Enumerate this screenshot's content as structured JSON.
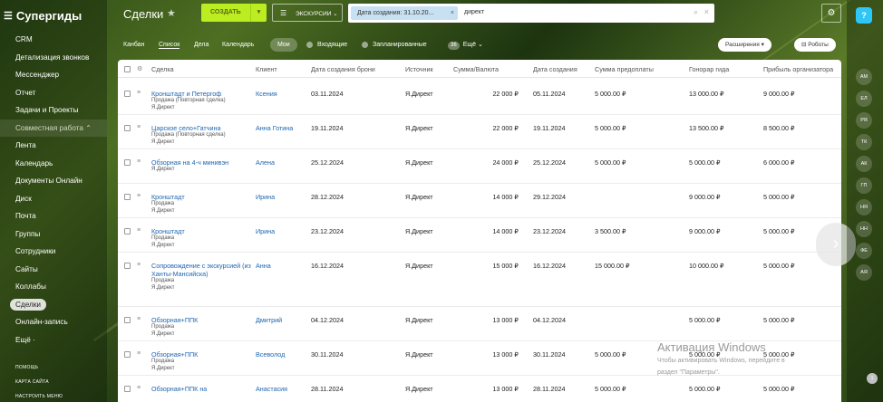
{
  "sidebar": {
    "brand": "Супергиды",
    "items": [
      {
        "label": "CRM"
      },
      {
        "label": "Детализация звонков"
      },
      {
        "label": "Мессенджер"
      },
      {
        "label": "Отчет"
      },
      {
        "label": "Задачи и Проекты"
      },
      {
        "label": "Совместная работа ⌃",
        "group": true
      },
      {
        "label": "Лента"
      },
      {
        "label": "Календарь"
      },
      {
        "label": "Документы Онлайн"
      },
      {
        "label": "Диск"
      },
      {
        "label": "Почта"
      },
      {
        "label": "Группы"
      },
      {
        "label": "Сотрудники"
      },
      {
        "label": "Сайты"
      },
      {
        "label": "Коллабы"
      },
      {
        "label": "Сделки",
        "active": true
      },
      {
        "label": "Онлайн-запись"
      },
      {
        "label": "Ещё ·"
      }
    ],
    "bottom": [
      "ПОМОЩЬ",
      "КАРТА САЙТА",
      "НАСТРОИТЬ МЕНЮ"
    ]
  },
  "header": {
    "title": "Сделки",
    "create_label": "СОЗДАТЬ",
    "excursions_label": "ЭКСКУРСИИ ⌄",
    "filter_chip": "Дата создания: 31.10.20...",
    "search_value": "директ"
  },
  "views": {
    "tabs": [
      "Канбан",
      "Список",
      "Дела",
      "Календарь"
    ],
    "active_tab": "Список",
    "my_label": "Мои",
    "incoming_label": "Входящие",
    "planned_label": "Запланированные",
    "more_count": "36",
    "more_label": "Ещё ⌄",
    "extensions_label": "Расширения ▾",
    "robots_label": "Роботы"
  },
  "table": {
    "columns": [
      "Сделка",
      "Клиент",
      "Дата создания брони",
      "Источник",
      "Сумма/Валюта",
      "Дата создания",
      "Сумма предоплаты",
      "Гонорар гида",
      "Прибыль организатора"
    ],
    "rows": [
      {
        "name": "Кронштадт и Петергоф",
        "sub1": "Продажа (Повторная сделка)",
        "sub2": "Я.Директ",
        "client": "Ксения",
        "booking": "03.11.2024",
        "source": "Я.Директ",
        "sum": "22 000 ₽",
        "created": "05.11.2024",
        "prepay": "5 000.00 ₽",
        "fee": "13 000.00 ₽",
        "profit": "9 000.00 ₽"
      },
      {
        "name": "Царское село+Гатчина",
        "sub1": "Продажа (Повторная сделка)",
        "sub2": "Я.Директ",
        "client": "Анна Готина",
        "booking": "19.11.2024",
        "source": "Я.Директ",
        "sum": "22 000 ₽",
        "created": "19.11.2024",
        "prepay": "5 000.00 ₽",
        "fee": "13 500.00 ₽",
        "profit": "8 500.00 ₽"
      },
      {
        "name": "Обзорная на 4-ч минивэн",
        "sub1": "",
        "sub2": "Я.Директ",
        "client": "Алена",
        "booking": "25.12.2024",
        "source": "Я.Директ",
        "sum": "24 000 ₽",
        "created": "25.12.2024",
        "prepay": "5 000.00 ₽",
        "fee": "5 000.00 ₽",
        "profit": "6 000.00 ₽"
      },
      {
        "name": "Кронштадт",
        "sub1": "Продажа",
        "sub2": "Я.Директ",
        "client": "Ирина",
        "booking": "28.12.2024",
        "source": "Я.Директ",
        "sum": "14 000 ₽",
        "created": "29.12.2024",
        "prepay": "",
        "fee": "9 000.00 ₽",
        "profit": "5 000.00 ₽"
      },
      {
        "name": "Кронштадт",
        "sub1": "Продажа",
        "sub2": "Я.Директ",
        "client": "Ирина",
        "booking": "23.12.2024",
        "source": "Я.Директ",
        "sum": "14 000 ₽",
        "created": "23.12.2024",
        "prepay": "3 500.00 ₽",
        "fee": "9 000.00 ₽",
        "profit": "5 000.00 ₽"
      },
      {
        "name": "Сопровождение с экскурсией (из Ханты-Мансийска)",
        "sub1": "Продажа",
        "sub2": "Я.Директ",
        "client": "Анна",
        "booking": "16.12.2024",
        "source": "Я.Директ",
        "sum": "15 000 ₽",
        "created": "16.12.2024",
        "prepay": "15 000.00 ₽",
        "fee": "10 000.00 ₽",
        "profit": "5 000.00 ₽"
      },
      {
        "name": "Обзорная+ППК",
        "sub1": "Продажа",
        "sub2": "Я.Директ",
        "client": "Дмитрий",
        "booking": "04.12.2024",
        "source": "Я.Директ",
        "sum": "13 000 ₽",
        "created": "04.12.2024",
        "prepay": "",
        "fee": "5 000.00 ₽",
        "profit": "5 000.00 ₽"
      },
      {
        "name": "Обзорная+ППК",
        "sub1": "Продажа",
        "sub2": "Я.Директ",
        "client": "Всеволод",
        "booking": "30.11.2024",
        "source": "Я.Директ",
        "sum": "13 000 ₽",
        "created": "30.11.2024",
        "prepay": "5 000.00 ₽",
        "fee": "5 000.00 ₽",
        "profit": "5 000.00 ₽"
      },
      {
        "name": "Обзорная+ППК на",
        "sub1": "",
        "sub2": "",
        "client": "Анастасия",
        "booking": "28.11.2024",
        "source": "Я.Директ",
        "sum": "13 000 ₽",
        "created": "28.11.2024",
        "prepay": "5 000.00 ₽",
        "fee": "5 000.00 ₽",
        "profit": "5 000.00 ₽"
      }
    ]
  },
  "right_panel": {
    "top_icon": "?",
    "avatars": [
      "АМ",
      "ЕЛ",
      "РЯ",
      "ТК",
      "АК",
      "ГП",
      "НЯ",
      "НН",
      "ФЕ",
      "АЯ"
    ],
    "badge": "1"
  },
  "watermark": {
    "title": "Активация Windows",
    "line1": "Чтобы активировать Windows, перейдите в",
    "line2": "раздел \"Параметры\"."
  }
}
